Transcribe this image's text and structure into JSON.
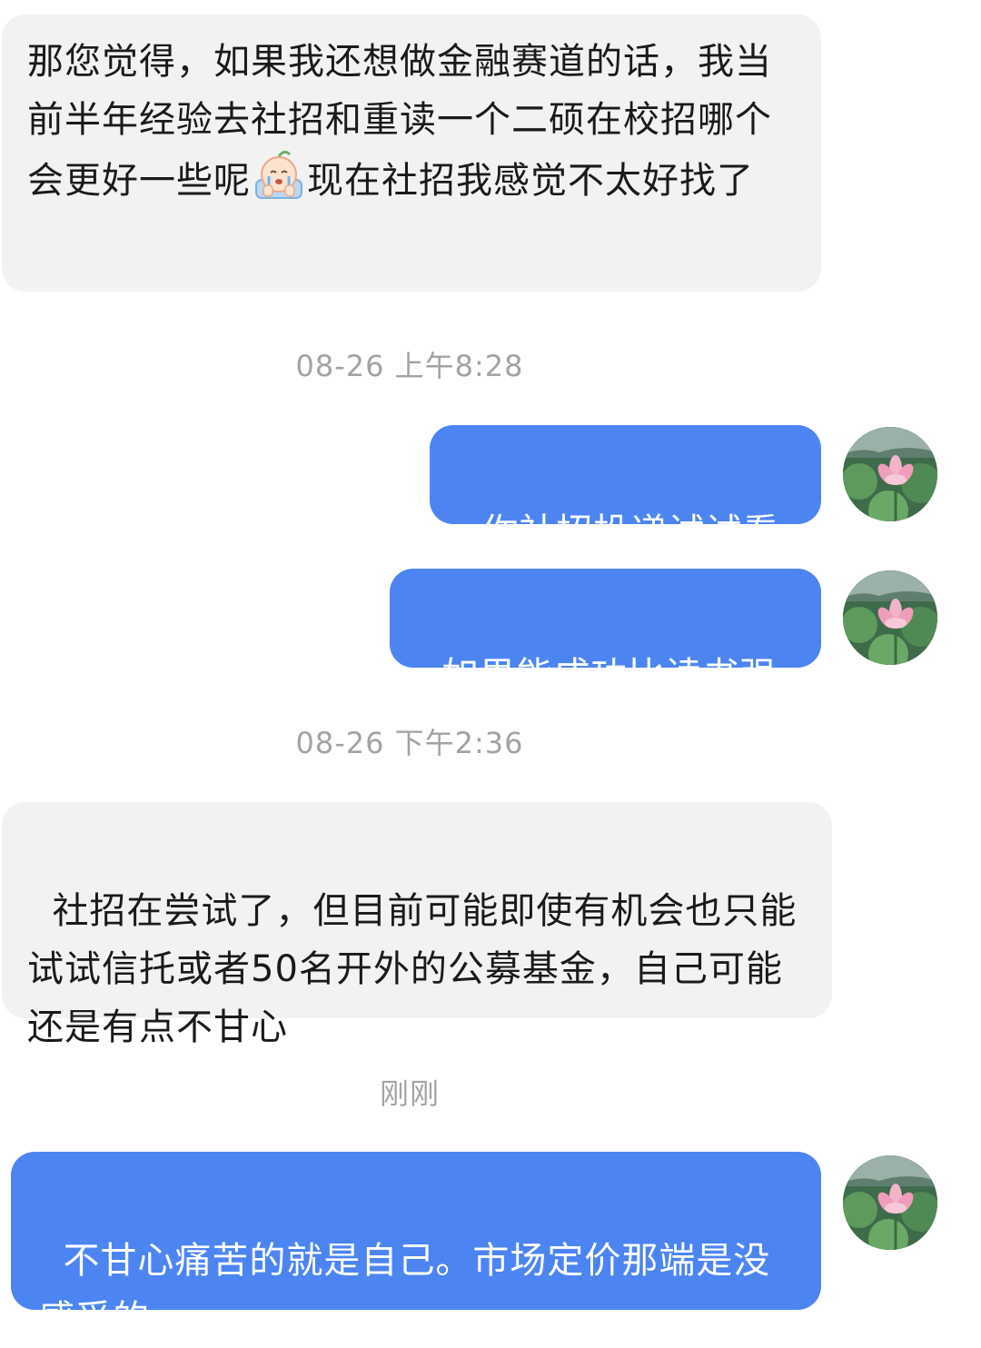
{
  "messages": [
    {
      "side": "received",
      "text_part1": "那您觉得，如果我还想做金融赛道的话，我当前半年经验去社招和重读一个二硕在校招哪个会更好一些呢",
      "emoji": "crying-face-emoji",
      "text_part2": "现在社招我感觉不太好找了"
    },
    {
      "timestamp": "08-26 上午8:28"
    },
    {
      "side": "sent",
      "text": "你社招投递试试看"
    },
    {
      "side": "sent",
      "text": "如果能成功比读书强"
    },
    {
      "timestamp": "08-26 下午2:36"
    },
    {
      "side": "received",
      "text": "社招在尝试了，但目前可能即使有机会也只能试试信托或者50名开外的公募基金，自己可能还是有点不甘心"
    },
    {
      "timestamp": "刚刚"
    },
    {
      "side": "sent",
      "text": "不甘心痛苦的就是自己。市场定价那端是没感受的"
    }
  ],
  "colors": {
    "sent_bubble": "#4c85f2",
    "received_bubble": "#f2f2f2",
    "timestamp_text": "#a3a3a3"
  },
  "avatar": {
    "icon": "lotus-avatar"
  }
}
